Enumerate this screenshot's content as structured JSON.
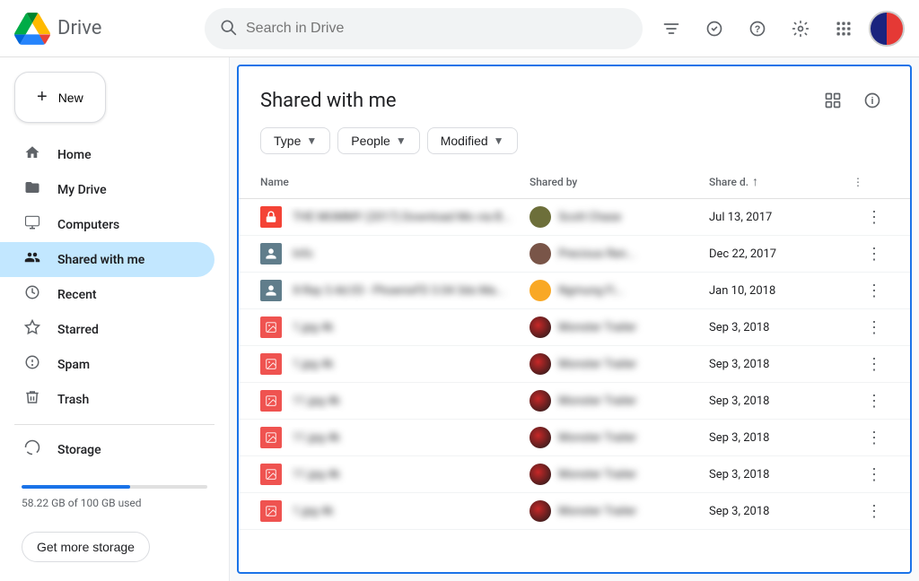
{
  "app": {
    "title": "Drive",
    "search_placeholder": "Search in Drive"
  },
  "topbar": {
    "filter_icon": "⚌",
    "tasks_icon": "✓",
    "help_icon": "?",
    "settings_icon": "⚙"
  },
  "sidebar": {
    "new_button": "New",
    "nav_items": [
      {
        "id": "home",
        "label": "Home",
        "icon": "🏠"
      },
      {
        "id": "my-drive",
        "label": "My Drive",
        "icon": "📁"
      },
      {
        "id": "computers",
        "label": "Computers",
        "icon": "🖥"
      },
      {
        "id": "shared-with-me",
        "label": "Shared with me",
        "icon": "👥",
        "active": true
      },
      {
        "id": "recent",
        "label": "Recent",
        "icon": "🕐"
      },
      {
        "id": "starred",
        "label": "Starred",
        "icon": "☆"
      },
      {
        "id": "spam",
        "label": "Spam",
        "icon": "⚠"
      },
      {
        "id": "trash",
        "label": "Trash",
        "icon": "🗑"
      },
      {
        "id": "storage",
        "label": "Storage",
        "icon": "☁"
      }
    ],
    "storage": {
      "text": "58.22 GB of 100 GB used",
      "used_gb": 58.22,
      "total_gb": 100,
      "percent": 58.22
    },
    "get_storage_btn": "Get more storage"
  },
  "main": {
    "title": "Shared with me",
    "filters": [
      {
        "id": "type",
        "label": "Type"
      },
      {
        "id": "people",
        "label": "People"
      },
      {
        "id": "modified",
        "label": "Modified"
      }
    ],
    "table_headers": [
      {
        "id": "name",
        "label": "Name"
      },
      {
        "id": "shared-by",
        "label": "Shared by"
      },
      {
        "id": "share-date",
        "label": "Share d."
      },
      {
        "id": "more",
        "label": ""
      }
    ],
    "files": [
      {
        "id": 1,
        "name": "THE MUMMY (2017) Download Mo via B...",
        "name_blurred": true,
        "icon_type": "red",
        "icon_char": "🔒",
        "shared_by": "Scott Chase",
        "shared_by_blurred": true,
        "avatar_color": "av-olive",
        "share_date": "Jul 13, 2017"
      },
      {
        "id": 2,
        "name": "Info",
        "name_blurred": true,
        "icon_type": "gray-person",
        "icon_char": "👤",
        "shared_by": "Precious Ren...",
        "shared_by_blurred": true,
        "avatar_color": "av-brown",
        "share_date": "Dec 22, 2017"
      },
      {
        "id": 3,
        "name": "X-Ray 3.4d.03 - PhoenixFD 3.04 3ds Ma...",
        "name_blurred": true,
        "icon_type": "gray-person",
        "icon_char": "👤",
        "shared_by": "Ngmung Fi...",
        "shared_by_blurred": true,
        "avatar_color": "av-yellow",
        "share_date": "Jan 10, 2018"
      },
      {
        "id": 4,
        "name": "1.jpg 4k",
        "name_blurred": true,
        "icon_type": "red-img",
        "icon_char": "🖼",
        "shared_by": "Monster Trailer",
        "shared_by_blurred": true,
        "avatar_color": "av-dark-red",
        "share_date": "Sep 3, 2018"
      },
      {
        "id": 5,
        "name": "1.jpg 4k",
        "name_blurred": true,
        "icon_type": "red-img",
        "icon_char": "🖼",
        "shared_by": "Monster Trailer",
        "shared_by_blurred": true,
        "avatar_color": "av-dark-red",
        "share_date": "Sep 3, 2018"
      },
      {
        "id": 6,
        "name": "11.jpg 4k",
        "name_blurred": true,
        "icon_type": "red-img",
        "icon_char": "🖼",
        "shared_by": "Monster Trailer",
        "shared_by_blurred": true,
        "avatar_color": "av-dark-red",
        "share_date": "Sep 3, 2018"
      },
      {
        "id": 7,
        "name": "11.jpg 4k",
        "name_blurred": true,
        "icon_type": "red-img",
        "icon_char": "🖼",
        "shared_by": "Monster Trailer",
        "shared_by_blurred": true,
        "avatar_color": "av-dark-red",
        "share_date": "Sep 3, 2018"
      },
      {
        "id": 8,
        "name": "11.jpg 4k",
        "name_blurred": true,
        "icon_type": "red-img",
        "icon_char": "🖼",
        "shared_by": "Monster Trailer",
        "shared_by_blurred": true,
        "avatar_color": "av-dark-red",
        "share_date": "Sep 3, 2018"
      },
      {
        "id": 9,
        "name": "1.jpg 4k",
        "name_blurred": true,
        "icon_type": "red-img",
        "icon_char": "🖼",
        "shared_by": "Monster Trailer",
        "shared_by_blurred": true,
        "avatar_color": "av-dark-red",
        "share_date": "Sep 3, 2018"
      }
    ]
  }
}
